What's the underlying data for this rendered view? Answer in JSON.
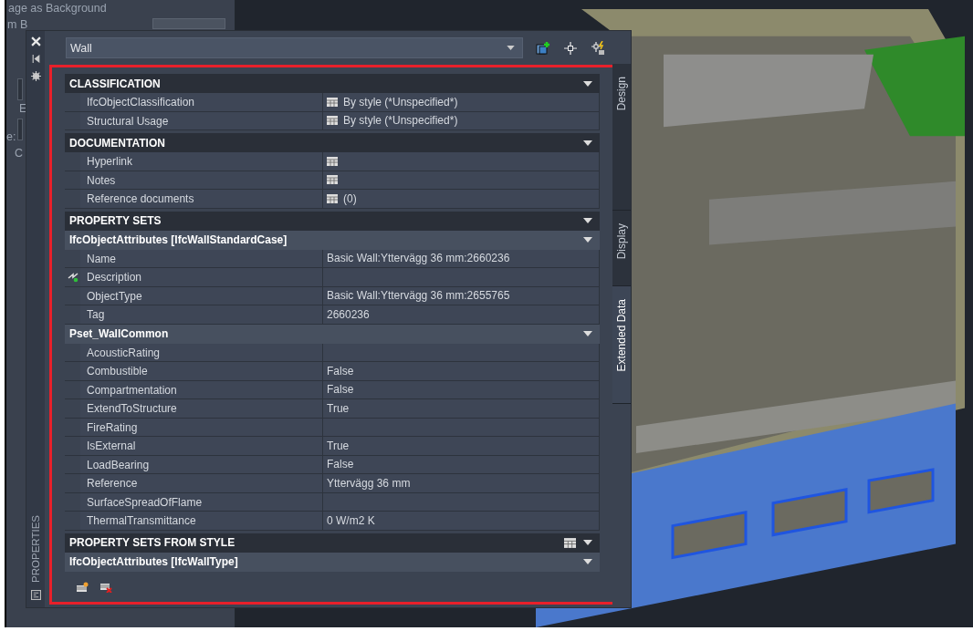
{
  "background_dialog": {
    "texts": [
      "age as Background",
      "m B",
      "E",
      "e:",
      "C"
    ]
  },
  "palette": {
    "title": "PROPERTIES",
    "object": "Wall",
    "tabs": [
      {
        "label": "Design",
        "selected": false
      },
      {
        "label": "Display",
        "selected": false
      },
      {
        "label": "Extended Data",
        "selected": true
      }
    ],
    "sections": [
      {
        "title": "CLASSIFICATION",
        "kind": "category",
        "table_icon": false,
        "rows": [
          {
            "label": "IfcObjectClassification",
            "value": "By style (*Unspecified*)",
            "table_icon": true,
            "linked": false
          },
          {
            "label": "Structural Usage",
            "value": "By style (*Unspecified*)",
            "table_icon": true,
            "linked": false
          }
        ]
      },
      {
        "title": "DOCUMENTATION",
        "kind": "category",
        "table_icon": false,
        "rows": [
          {
            "label": "Hyperlink",
            "table_icon": true,
            "linked": false
          },
          {
            "label": "Notes",
            "table_icon": true,
            "linked": false
          },
          {
            "label": "Reference documents",
            "value": "(0)",
            "table_icon": true,
            "linked": false
          }
        ]
      },
      {
        "title": "PROPERTY SETS",
        "kind": "category",
        "table_icon": false
      },
      {
        "title": "IfcObjectAttributes [IfcWallStandardCase]",
        "kind": "set",
        "table_icon": false,
        "rows": [
          {
            "label": "Name",
            "value": "Basic Wall:Yttervägg 36 mm:2660236",
            "table_icon": false,
            "linked": false
          },
          {
            "label": "Description",
            "table_icon": false,
            "linked": true
          },
          {
            "label": "ObjectType",
            "value": "Basic Wall:Yttervägg 36 mm:2655765",
            "table_icon": false,
            "linked": false
          },
          {
            "label": "Tag",
            "value": "2660236",
            "table_icon": false,
            "linked": false
          }
        ]
      },
      {
        "title": "Pset_WallCommon",
        "kind": "set",
        "table_icon": false,
        "rows": [
          {
            "label": "AcousticRating",
            "table_icon": false,
            "linked": false
          },
          {
            "label": "Combustible",
            "value": "False",
            "table_icon": false,
            "linked": false
          },
          {
            "label": "Compartmentation",
            "value": "False",
            "table_icon": false,
            "linked": false
          },
          {
            "label": "ExtendToStructure",
            "value": "True",
            "table_icon": false,
            "linked": false
          },
          {
            "label": "FireRating",
            "table_icon": false,
            "linked": false
          },
          {
            "label": "IsExternal",
            "value": "True",
            "table_icon": false,
            "linked": false
          },
          {
            "label": "LoadBearing",
            "value": "False",
            "table_icon": false,
            "linked": false
          },
          {
            "label": "Reference",
            "value": "Yttervägg 36 mm",
            "table_icon": false,
            "linked": false
          },
          {
            "label": "SurfaceSpreadOfFlame",
            "table_icon": false,
            "linked": false
          },
          {
            "label": "ThermalTransmittance",
            "value": "0 W/m2 K",
            "table_icon": false,
            "linked": false
          }
        ]
      },
      {
        "title": "PROPERTY SETS FROM STYLE",
        "kind": "category",
        "table_icon": true
      },
      {
        "title": "IfcObjectAttributes [IfcWallType]",
        "kind": "set",
        "table_icon": false
      }
    ]
  }
}
